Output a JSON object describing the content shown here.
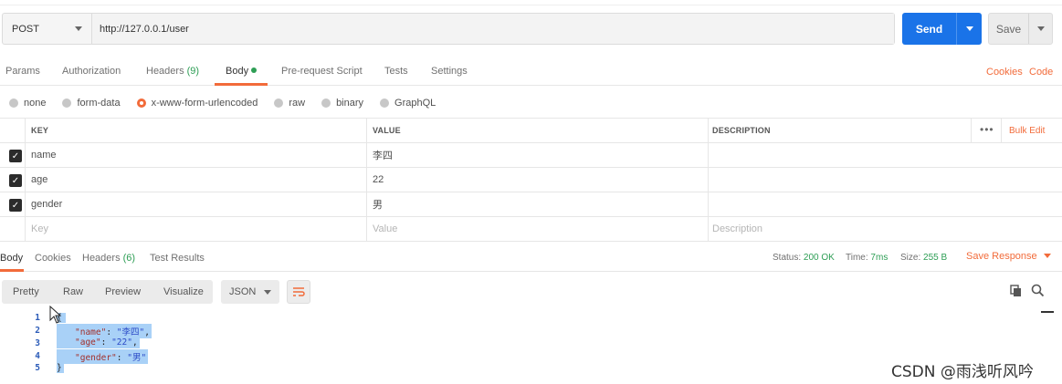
{
  "request": {
    "method": "POST",
    "url": "http://127.0.0.1/user",
    "send_label": "Send",
    "save_label": "Save"
  },
  "request_tabs": {
    "params": "Params",
    "authorization": "Authorization",
    "headers": "Headers",
    "headers_count": "(9)",
    "body": "Body",
    "prerequest": "Pre-request Script",
    "tests": "Tests",
    "settings": "Settings",
    "cookies": "Cookies",
    "code": "Code"
  },
  "body_types": {
    "none": "none",
    "form_data": "form-data",
    "urlencoded": "x-www-form-urlencoded",
    "raw": "raw",
    "binary": "binary",
    "graphql": "GraphQL",
    "selected": "x-www-form-urlencoded"
  },
  "table": {
    "headers": {
      "key": "KEY",
      "value": "VALUE",
      "description": "DESCRIPTION",
      "bulk_edit": "Bulk Edit",
      "more": "•••"
    },
    "rows": [
      {
        "key": "name",
        "value": "李四",
        "description": "",
        "checked": true
      },
      {
        "key": "age",
        "value": "22",
        "description": "",
        "checked": true
      },
      {
        "key": "gender",
        "value": "男",
        "description": "",
        "checked": true
      }
    ],
    "placeholder": {
      "key": "Key",
      "value": "Value",
      "description": "Description"
    }
  },
  "response_tabs": {
    "body": "Body",
    "cookies": "Cookies",
    "headers": "Headers",
    "headers_count": "(6)",
    "test_results": "Test Results"
  },
  "status": {
    "status_label": "Status:",
    "status_value": "200 OK",
    "time_label": "Time:",
    "time_value": "7ms",
    "size_label": "Size:",
    "size_value": "255 B",
    "save_response": "Save Response"
  },
  "view_modes": {
    "pretty": "Pretty",
    "raw": "Raw",
    "preview": "Preview",
    "visualize": "Visualize",
    "format": "JSON"
  },
  "code": {
    "line_numbers": [
      "1",
      "2",
      "3",
      "4",
      "5"
    ],
    "open_brace": "{",
    "close_brace": "}",
    "name_key": "\"name\"",
    "name_val": "\"李四\"",
    "age_key": "\"age\"",
    "age_val": "\"22\"",
    "gender_key": "\"gender\"",
    "gender_val": "\"男\""
  },
  "watermark": "CSDN @雨浅听风吟",
  "colors": {
    "accent": "#f26b3a",
    "primary": "#1a73e8",
    "success": "#2e9e55",
    "highlight": "#a9d1f7"
  }
}
